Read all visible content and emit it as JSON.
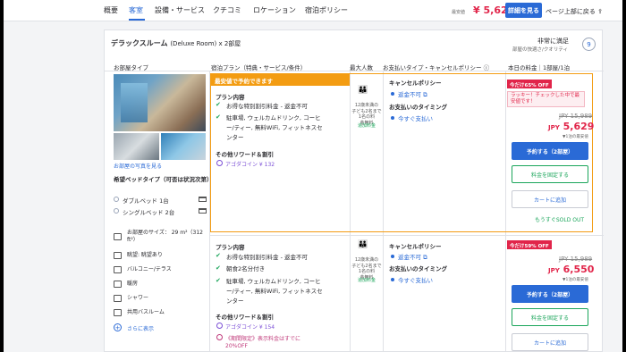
{
  "nav": {
    "tabs": [
      "概要",
      "客室",
      "設備・サービス",
      "クチコミ",
      "ロケーション",
      "宿泊ポリシー"
    ],
    "price_from": "最安値",
    "price": "¥ 5,629",
    "detail_button": "詳細を見る",
    "back_top": "ページ上部に戻る"
  },
  "room": {
    "title": "デラックスルーム",
    "title_sub": "(Deluxe Room) x 2部屋",
    "comfort": "非常に満足",
    "comfort_sub": "部屋の快適さ/クオリティ"
  },
  "headers": {
    "room_type": "お部屋タイプ",
    "plan": "宿泊プラン（特典・サービス/条件）",
    "max_people": "最大人数",
    "payment_type": "お支払いタイプ・キャンセルポリシー",
    "price_today": "本日の料金｜1部屋/1泊"
  },
  "left": {
    "photo_link": "お部屋の写真を見る",
    "bed_title": "希望ベッドタイプ（可否は状況次第）",
    "beds": [
      "ダブルベッド 1台",
      "シングルベッド 2台"
    ],
    "amenities": [
      "お部屋のサイズ： 29 m²（312 ft²）",
      "眺望: 眺望あり",
      "バルコニー/テラス",
      "暖房",
      "シャワー",
      "共用バスルーム"
    ],
    "more": "さらに表示"
  },
  "plan1": {
    "banner": "最安値で予約できます",
    "contents_title": "プラン内容",
    "items": [
      "お得な特別割引料金 - 返金不可",
      "駐車場, ウェルカムドリンク, コーヒ",
      "ー/ティー, 無料WiFi, フィットネスセ",
      "ンター"
    ],
    "reward_title": "その他リワード＆割引",
    "coin": "アゴダコイン ¥ 132",
    "occ_text": "12歳未満の\n子ども2名まで\n1名の料\n金無料",
    "occ_link": "追加料金",
    "cancel_title": "キャンセルポリシー",
    "cancel_item": "返金不可",
    "pay_title": "お支払いのタイミング",
    "pay_item": "今すぐ支払い",
    "deal": "今だけ65% OFF",
    "luck": "ラッキー！チェックした中で最安値です！",
    "old_price": "JPY 15,989",
    "cur": "JPY",
    "new_price": "5,629",
    "per_night": "▼1泊の最安値",
    "btn_book": "予約する（2部屋）",
    "btn_fix": "料金を固定する",
    "btn_cart": "カートに追加",
    "soldout": "もうすぐSOLD OUT"
  },
  "plan2": {
    "contents_title": "プラン内容",
    "items": [
      "お得な特別割引料金 - 返金不可",
      "朝食2名分付き",
      "駐車場, ウェルカムドリンク, コーヒ",
      "ー/ティー, 無料WiFi, フィットネスセ",
      "ンター"
    ],
    "reward_title": "その他リワード＆割引",
    "coin": "アゴダコイン ¥ 154",
    "promo": "《期間限定》表示料金はすでに",
    "promo2": "20%OFF",
    "occ_text": "12歳未満の\n子ども2名まで\n1名の料\n金無料",
    "occ_link": "追加料金",
    "cancel_title": "キャンセルポリシー",
    "cancel_item": "返金不可",
    "pay_title": "お支払いのタイミング",
    "pay_item": "今すぐ支払い",
    "deal": "今だけ59% OFF",
    "old_price": "JPY 15,989",
    "cur": "JPY",
    "new_price": "6,550",
    "per_night": "▼1泊の最安値",
    "btn_book": "予約する（2部屋）",
    "btn_fix": "料金を固定する",
    "btn_cart": "カートに追加"
  }
}
